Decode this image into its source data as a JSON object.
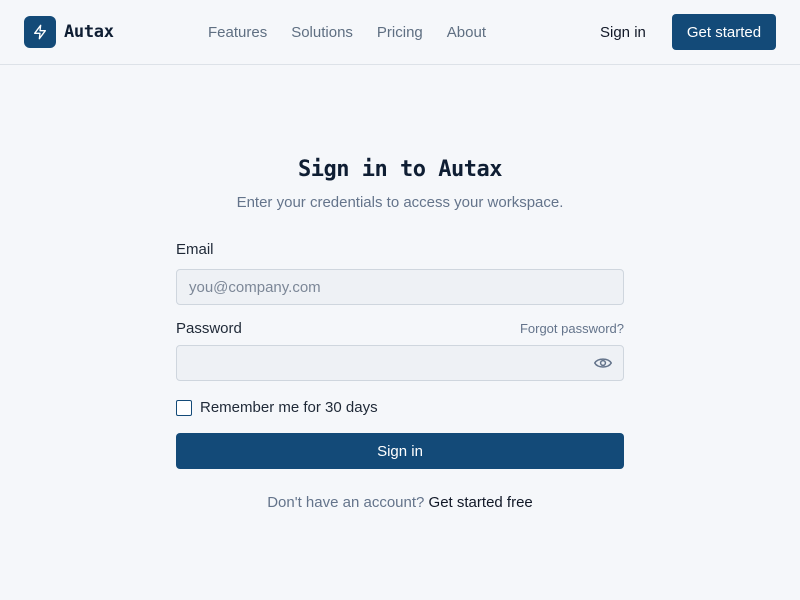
{
  "header": {
    "brand": "Autax",
    "nav": [
      "Features",
      "Solutions",
      "Pricing",
      "About"
    ],
    "sign_in": "Sign in",
    "cta": "Get started"
  },
  "form": {
    "title": "Sign in to Autax",
    "subtitle": "Enter your credentials to access your workspace.",
    "email_label": "Email",
    "email_placeholder": "you@company.com",
    "email_value": "",
    "password_label": "Password",
    "forgot": "Forgot password?",
    "password_value": "",
    "remember_label": "Remember me for 30 days",
    "remember_checked": false,
    "submit": "Sign in",
    "footer_text": "Don't have an account?",
    "footer_link": "Get started free"
  },
  "icons": {
    "logo": "lightning-bolt-icon",
    "password_toggle": "eye-icon"
  },
  "colors": {
    "primary": "#134a78",
    "background": "#f5f7fa"
  }
}
